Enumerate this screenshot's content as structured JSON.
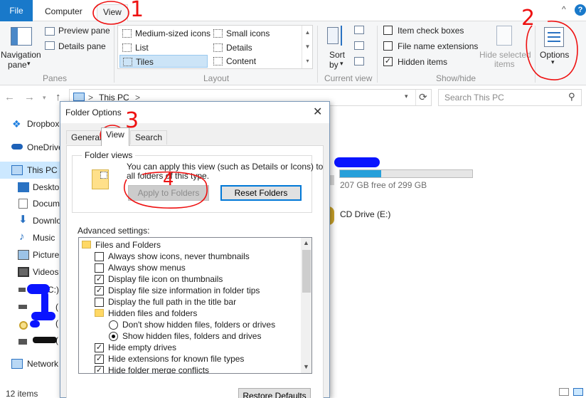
{
  "ribbon_tabs": {
    "file": "File",
    "computer": "Computer",
    "view": "View"
  },
  "window_controls": {
    "minimize_caret": "^",
    "help": "?"
  },
  "panes": {
    "navigation": "Navigation",
    "navigation_2": "pane",
    "preview": "Preview pane",
    "details": "Details pane",
    "group": "Panes"
  },
  "layout": {
    "items": [
      "Medium-sized icons",
      "Small icons",
      "List",
      "Details",
      "Tiles",
      "Content"
    ],
    "selected": "Tiles",
    "group": "Layout"
  },
  "current_view": {
    "sort": "Sort",
    "sort_2": "by",
    "group": "Current view"
  },
  "show_hide": {
    "item_check_boxes": "Item check boxes",
    "file_name_extensions": "File name extensions",
    "hidden_items": "Hidden items",
    "hide_selected": "Hide selected",
    "hide_selected_2": "items",
    "group": "Show/hide",
    "item_check_boxes_checked": false,
    "file_name_extensions_checked": false,
    "hidden_items_checked": true
  },
  "options": {
    "label": "Options"
  },
  "address": {
    "path": "This PC",
    "separator": ">",
    "search_placeholder": "Search This PC"
  },
  "nav_pane": {
    "items": [
      "Dropbox",
      "OneDrive",
      "This PC",
      "Deskto",
      "Docum",
      "Downlo",
      "Music",
      "Picture",
      "Videos",
      "C:)",
      "(",
      "(",
      "(",
      "Network"
    ],
    "status": "12 items"
  },
  "content": {
    "drive_free": "207 GB free of 299 GB",
    "drive_used_fraction": 0.31,
    "cd_drive": "CD Drive (E:)"
  },
  "dialog": {
    "title": "Folder Options",
    "tabs": [
      "General",
      "View",
      "Search"
    ],
    "active_tab": "View",
    "folder_views_label": "Folder views",
    "folder_views_text_1": "You can apply this view (such as Details or Icons) to",
    "folder_views_text_2": "all folders of this type.",
    "apply_button": "Apply to Folders",
    "reset_button": "Reset Folders",
    "advanced_label": "Advanced settings:",
    "advanced_items": [
      {
        "label": "Files and Folders",
        "kind": "folder"
      },
      {
        "label": "Always show icons, never thumbnails",
        "kind": "check",
        "checked": false
      },
      {
        "label": "Always show menus",
        "kind": "check",
        "checked": false
      },
      {
        "label": "Display file icon on thumbnails",
        "kind": "check",
        "checked": true
      },
      {
        "label": "Display file size information in folder tips",
        "kind": "check",
        "checked": true
      },
      {
        "label": "Display the full path in the title bar",
        "kind": "check",
        "checked": false
      },
      {
        "label": "Hidden files and folders",
        "kind": "folder"
      },
      {
        "label": "Don't show hidden files, folders or drives",
        "kind": "radio",
        "checked": false
      },
      {
        "label": "Show hidden files, folders and drives",
        "kind": "radio",
        "checked": true
      },
      {
        "label": "Hide empty drives",
        "kind": "check",
        "checked": true
      },
      {
        "label": "Hide extensions for known file types",
        "kind": "check",
        "checked": true
      },
      {
        "label": "Hide folder merge conflicts",
        "kind": "check",
        "checked": true
      }
    ],
    "restore_button": "Restore Defaults"
  },
  "annotations": [
    "1",
    "2",
    "3",
    "4"
  ],
  "colors": {
    "accent": "#1979ca",
    "selection": "#cce8ff",
    "annotation": "#ee1111",
    "redaction": "#0000ff"
  }
}
